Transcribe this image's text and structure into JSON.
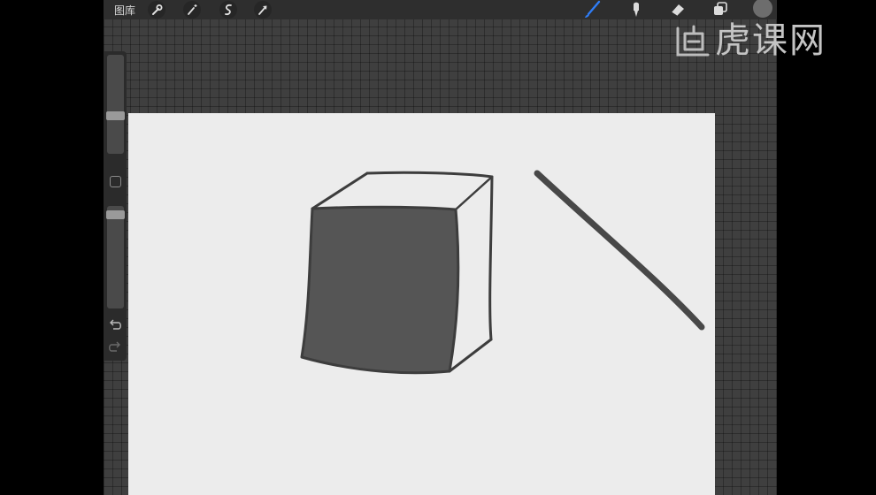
{
  "toolbar": {
    "gallery_label": "图库",
    "left_icons": [
      "wrench-icon",
      "magic-wand-icon",
      "selection-s-icon",
      "arrow-transform-icon"
    ],
    "right_icons": [
      "brush-icon",
      "smudge-icon",
      "eraser-icon",
      "layers-icon"
    ],
    "active_tool": "brush",
    "active_tool_color": "#2f7df6",
    "current_color": "#6d6d6d"
  },
  "sidebar": {
    "brush_size_level": 0.37,
    "opacity_level": 0.05,
    "modify_button": "square",
    "undo_icon": "undo-icon",
    "redo_icon": "redo-icon"
  },
  "canvas": {
    "background": "#ececec",
    "ink_color": "#3d3d3d",
    "fill_color": "#555555"
  },
  "watermark": {
    "text": "虎课网",
    "logo": "tiger-logo-icon"
  }
}
